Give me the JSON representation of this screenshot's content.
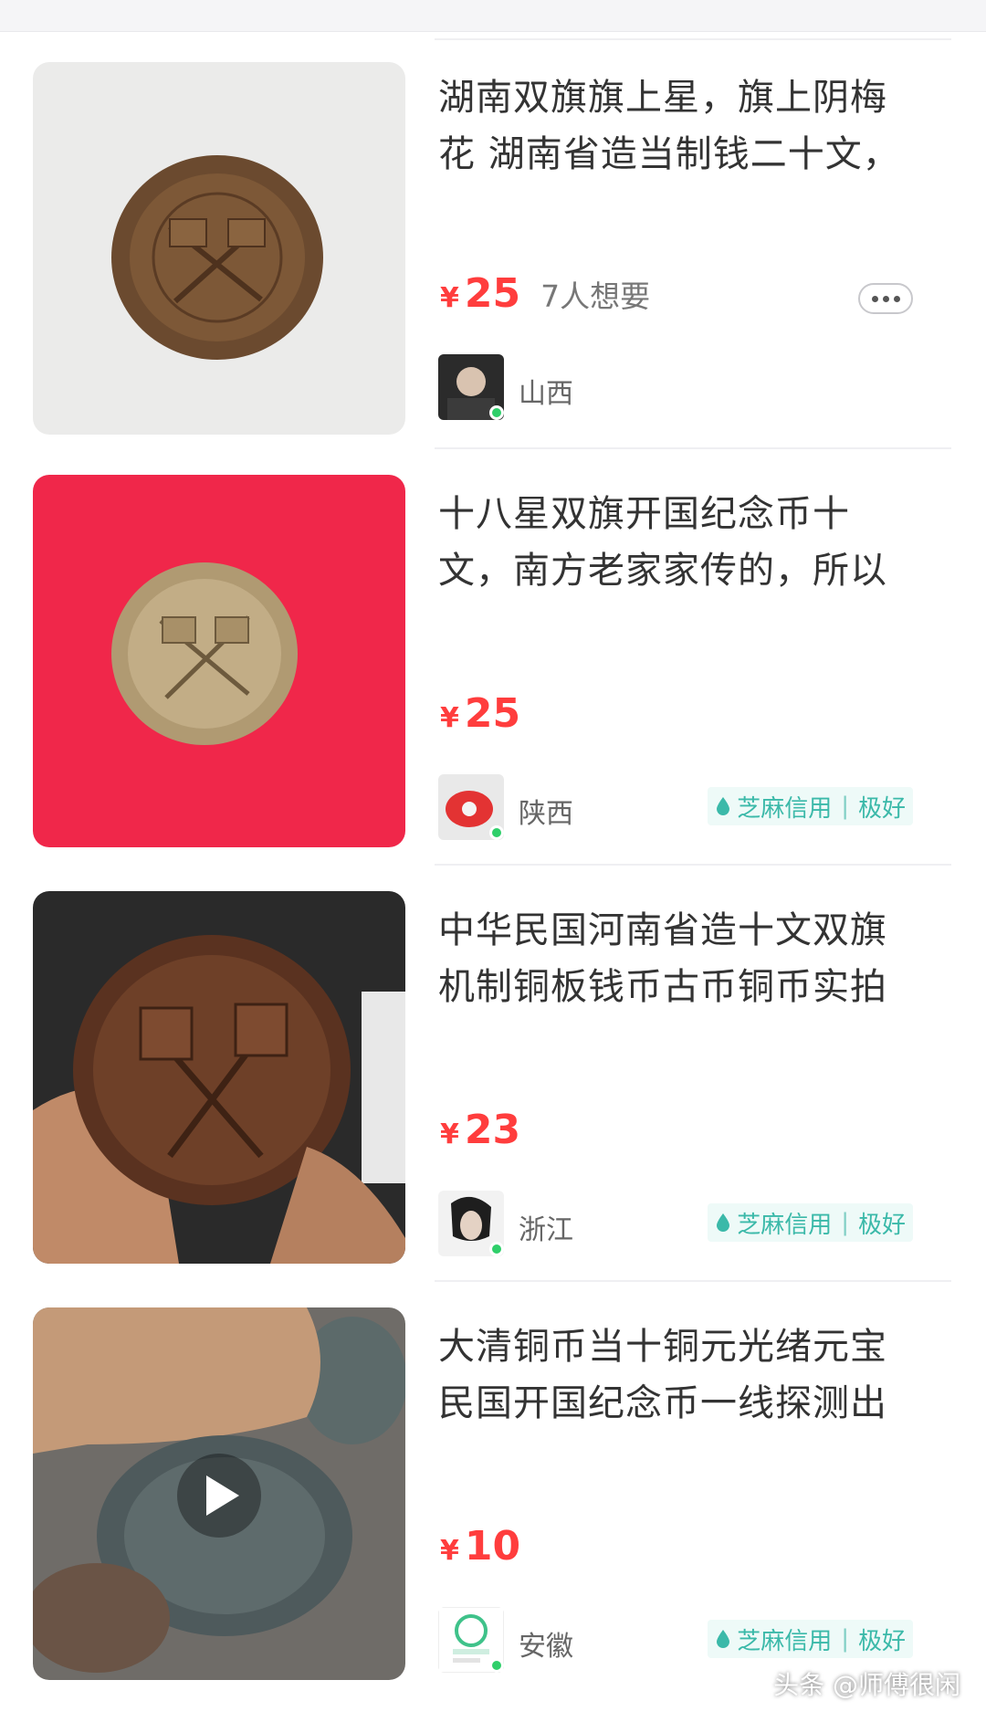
{
  "listings": [
    {
      "title": "湖南双旗旗上星，旗上阴梅花 湖南省造当制钱二十文，",
      "currency": "¥",
      "price": "25",
      "want": "7人想要",
      "location": "山西",
      "image_icon": "coin-photo",
      "avatar_icon": "avatar-photo"
    },
    {
      "title": "十八星双旗开国纪念币十文，南方老家家传的，所以",
      "currency": "¥",
      "price": "25",
      "location": "陕西",
      "credit": {
        "brand": "芝麻信用",
        "sep": "|",
        "level": "极好"
      },
      "image_icon": "coin-photo",
      "avatar_icon": "avatar-photo"
    },
    {
      "title": "中华民国河南省造十文双旗机制铜板钱币古币铜币实拍",
      "currency": "¥",
      "price": "23",
      "location": "浙江",
      "credit": {
        "brand": "芝麻信用",
        "sep": "|",
        "level": "极好"
      },
      "image_icon": "coin-photo",
      "avatar_icon": "avatar-photo"
    },
    {
      "title": "大清铜币当十铜元光绪元宝民国开国纪念币一线探测出",
      "currency": "¥",
      "price": "10",
      "location": "安徽",
      "credit": {
        "brand": "芝麻信用",
        "sep": "|",
        "level": "极好"
      },
      "image_icon": "video-play-icon",
      "avatar_icon": "avatar-photo"
    }
  ],
  "watermark": "头条 @师傅很闲",
  "colors": {
    "price": "#ff3d3d",
    "credit": "#3bb9a9",
    "online": "#2fcf6a"
  }
}
